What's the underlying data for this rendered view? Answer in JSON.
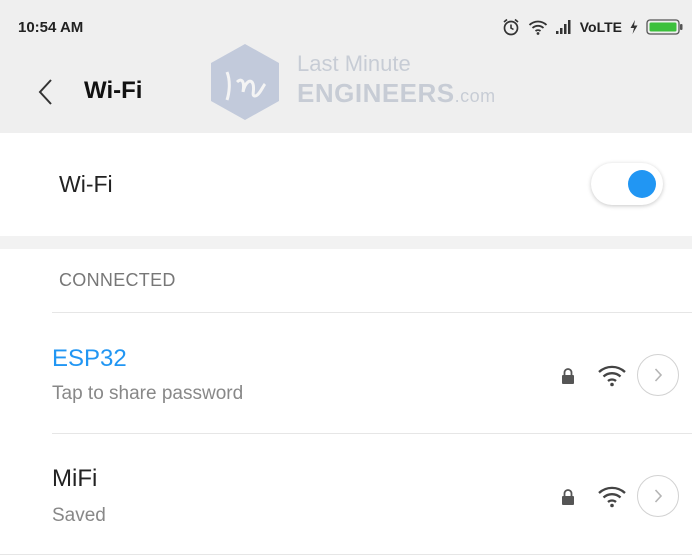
{
  "status_bar": {
    "time": "10:54 AM",
    "network_label": "VoLTE",
    "icons": [
      "alarm-icon",
      "wifi-icon",
      "signal-icon",
      "charging-icon",
      "battery-icon"
    ]
  },
  "header": {
    "title": "Wi-Fi",
    "back_icon": "chevron-left-icon"
  },
  "watermark": {
    "line1": "Last Minute",
    "line2": "ENGINEERS",
    "line2_suffix": ".com"
  },
  "wifi_toggle": {
    "label": "Wi-Fi",
    "on": true
  },
  "section": {
    "header": "CONNECTED"
  },
  "networks": [
    {
      "name": "ESP32",
      "status": "Tap to share password",
      "secured": true,
      "name_color": "#2196f3"
    },
    {
      "name": "MiFi",
      "status": "Saved",
      "secured": true,
      "name_color": "#222222"
    }
  ],
  "colors": {
    "accent": "#2196f3",
    "top_bar_bg": "#efefef",
    "battery_green": "#3cc03c"
  }
}
